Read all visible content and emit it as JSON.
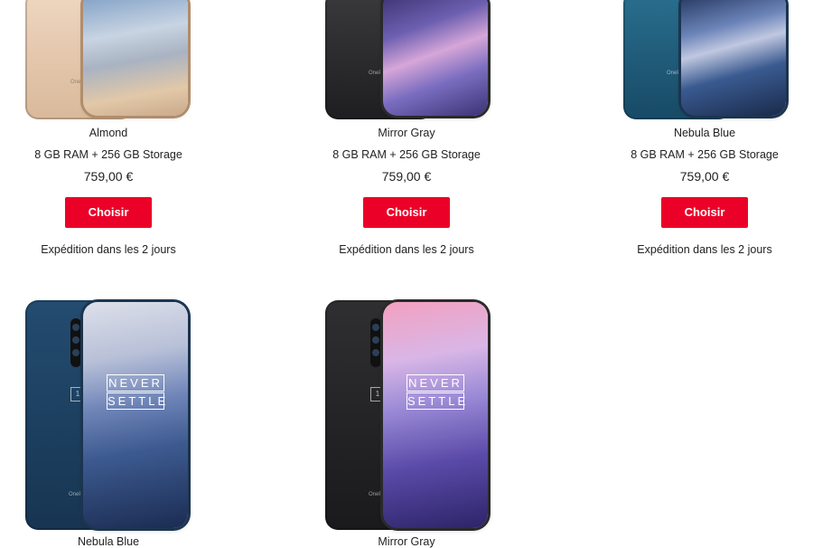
{
  "products": [
    {
      "color_name": "Almond",
      "spec": "8 GB RAM + 256 GB Storage",
      "price": "759,00 €",
      "button_label": "Choisir",
      "shipping": "Expédition dans les 2 jours",
      "back_color": "#e6cdb5",
      "screen_color": "#a9b6c6",
      "brand_text": "OneP"
    },
    {
      "color_name": "Mirror Gray",
      "spec": "8 GB RAM + 256 GB Storage",
      "price": "759,00 €",
      "button_label": "Choisir",
      "shipping": "Expédition dans les 2 jours",
      "back_color": "#2c2c2e",
      "screen_color": "#6a5aa6",
      "brand_text": "OneP"
    },
    {
      "color_name": "Nebula Blue",
      "spec": "8 GB RAM + 256 GB Storage",
      "price": "759,00 €",
      "button_label": "Choisir",
      "shipping": "Expédition dans les 2 jours",
      "back_color": "#1f5a7a",
      "screen_color": "#3c5a88",
      "brand_text": "OneP"
    },
    {
      "color_name": "Nebula Blue",
      "back_color": "#21486a",
      "screen_color": "#5a6fa0",
      "brand_text": "OneP",
      "screen_line1": "NEVER",
      "screen_line2": "SETTLE"
    },
    {
      "color_name": "Mirror Gray",
      "back_color": "#2a2a2c",
      "screen_color": "#8a78c8",
      "brand_text": "OneP",
      "screen_line1": "NEVER",
      "screen_line2": "SETTLE"
    }
  ],
  "accent_color": "#eb0028"
}
